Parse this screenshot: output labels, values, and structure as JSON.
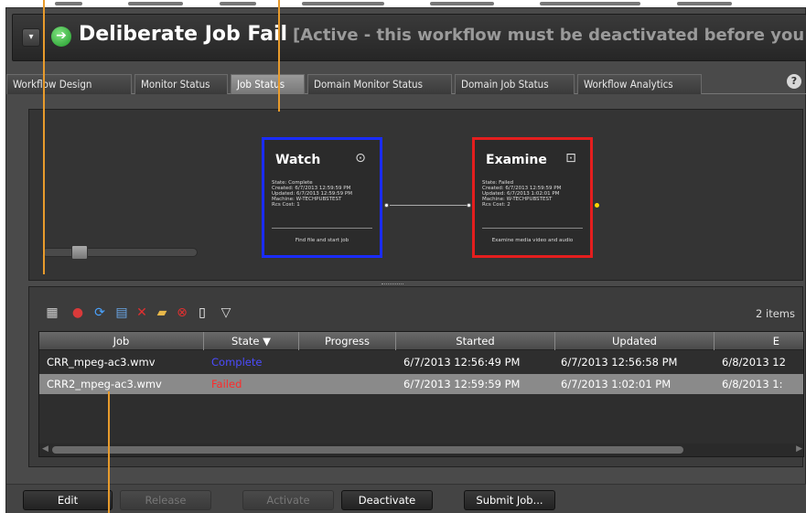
{
  "header": {
    "title": "Deliberate Job Fail",
    "subtitle": "[Active - this workflow must be deactivated before you can edi",
    "collapse_glyph": "▾",
    "go_glyph": "➔"
  },
  "tabs": [
    {
      "label": "Workflow Design"
    },
    {
      "label": "Monitor Status"
    },
    {
      "label": "Job Status"
    },
    {
      "label": "Domain Monitor Status"
    },
    {
      "label": "Domain Job Status"
    },
    {
      "label": "Workflow Analytics"
    }
  ],
  "help_glyph": "?",
  "nodes": {
    "watch": {
      "title": "Watch",
      "icon": "play-icon",
      "icon_glyph": "⊙",
      "state": "State: Complete",
      "created": "Created: 6/7/2013 12:59:59 PM",
      "updated": "Updated: 6/7/2013 12:59:59 PM",
      "machine": "Machine: W-TECHPUBSTEST",
      "rcs_cost": "Rcs Cost: 1",
      "footer": "Find file and start job",
      "border_color": "#1a2cff"
    },
    "examine": {
      "title": "Examine",
      "icon": "media-examine-icon",
      "icon_glyph": "⊡",
      "state": "State: Failed",
      "created": "Created: 6/7/2013 12:59:59 PM",
      "updated": "Updated: 6/7/2013 1:02:01 PM",
      "machine": "Machine: W-TECHPUBSTEST",
      "rcs_cost": "Rcs Cost: 2",
      "footer": "Examine media video and audio",
      "border_color": "#e41e1e"
    }
  },
  "toolbar": {
    "icons": [
      {
        "name": "columns-icon",
        "glyph": "▦",
        "color": "#cfcfcf"
      },
      {
        "name": "stop-icon",
        "glyph": "●",
        "color": "#d93a3a"
      },
      {
        "name": "refresh-icon",
        "glyph": "⟳",
        "color": "#4aa3ff"
      },
      {
        "name": "calendar-icon",
        "glyph": "▤",
        "color": "#6aa7e8"
      },
      {
        "name": "delete-icon",
        "glyph": "✕",
        "color": "#e23030"
      },
      {
        "name": "folder-icon",
        "glyph": "▰",
        "color": "#e8b84a"
      },
      {
        "name": "cancel-icon",
        "glyph": "⊗",
        "color": "#e23030"
      },
      {
        "name": "document-icon",
        "glyph": "▯",
        "color": "#ffffff"
      },
      {
        "name": "filter-icon",
        "glyph": "▽",
        "color": "#dddddd"
      }
    ],
    "item_count": "2 items"
  },
  "table": {
    "columns": [
      {
        "label": "Job"
      },
      {
        "label": "State ▼"
      },
      {
        "label": "Progress"
      },
      {
        "label": "Started"
      },
      {
        "label": "Updated"
      },
      {
        "label": "E"
      }
    ],
    "rows": [
      {
        "job": "CRR_mpeg-ac3.wmv",
        "state": "Complete",
        "state_color": "#4c4cff",
        "progress": "",
        "started": "6/7/2013 12:56:49 PM",
        "updated": "6/7/2013 12:56:58 PM",
        "ended": "6/8/2013 12",
        "selected": false
      },
      {
        "job": "CRR2_mpeg-ac3.wmv",
        "state": "Failed",
        "state_color": "#ff2a2a",
        "progress": "",
        "started": "6/7/2013 12:59:59 PM",
        "updated": "6/7/2013 1:02:01 PM",
        "ended": "6/8/2013 1:",
        "selected": true
      }
    ]
  },
  "footer_buttons": [
    {
      "label": "Edit",
      "enabled": true
    },
    {
      "label": "Release",
      "enabled": false
    },
    {
      "label": "Activate",
      "enabled": false
    },
    {
      "label": "Deactivate",
      "enabled": true
    },
    {
      "label": "Submit Job...",
      "enabled": true
    }
  ],
  "colors": {
    "callout": "#e89b2c",
    "connector_port_yellow": "#ffd800"
  }
}
